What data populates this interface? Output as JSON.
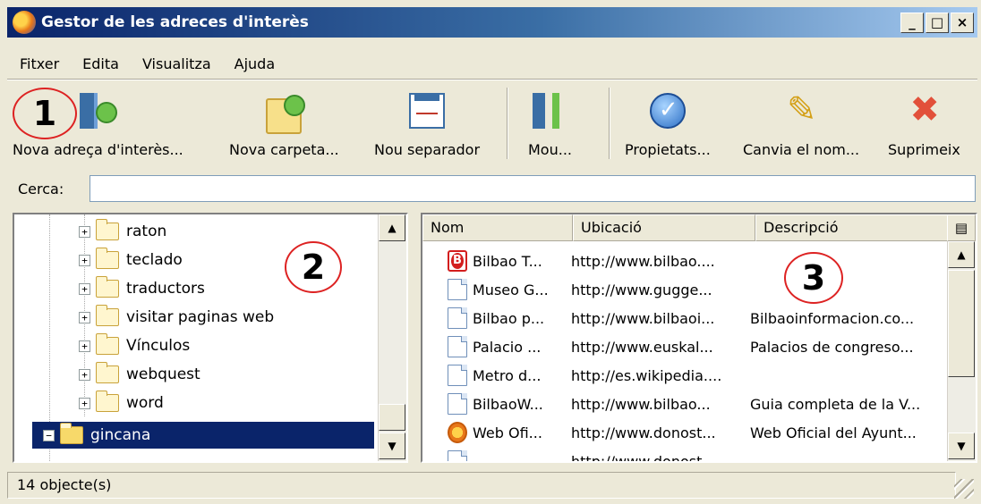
{
  "window": {
    "title": "Gestor de les adreces d'interès",
    "controls": [
      "_",
      "□",
      "×"
    ]
  },
  "menu": [
    "Fitxer",
    "Edita",
    "Visualitza",
    "Ajuda"
  ],
  "toolbar": {
    "new_bookmark": "Nova adreça d'interès...",
    "new_folder": "Nova carpeta...",
    "new_separator": "Nou separador",
    "move": "Mou...",
    "properties": "Propietats...",
    "rename": "Canvia el nom...",
    "delete": "Suprimeix"
  },
  "markers": [
    "1",
    "2",
    "3"
  ],
  "search": {
    "label": "Cerca:",
    "value": ""
  },
  "tree": {
    "items": [
      "raton",
      "teclado",
      "traductors",
      "visitar paginas web",
      "Vínculos",
      "webquest",
      "word"
    ],
    "selected": "gincana"
  },
  "list": {
    "columns": [
      "Nom",
      "Ubicació",
      "Descripció"
    ],
    "rows": [
      {
        "icon": "bilbao-logo-icon",
        "name": "Bilbao T...",
        "url": "http://www.bilbao....",
        "desc": ""
      },
      {
        "icon": "page-icon",
        "name": "Museo G...",
        "url": "http://www.gugge...",
        "desc": ""
      },
      {
        "icon": "page-icon",
        "name": "Bilbao p...",
        "url": "http://www.bilbaoi...",
        "desc": "Bilbaoinformacion.co..."
      },
      {
        "icon": "page-icon",
        "name": "Palacio ...",
        "url": "http://www.euskal...",
        "desc": "Palacios de congreso..."
      },
      {
        "icon": "page-icon",
        "name": "Metro d...",
        "url": "http://es.wikipedia....",
        "desc": ""
      },
      {
        "icon": "page-icon",
        "name": "BilbaoW...",
        "url": "http://www.bilbao...",
        "desc": "Guia completa de la V..."
      },
      {
        "icon": "donostia-logo-icon",
        "name": "Web Ofi...",
        "url": "http://www.donost...",
        "desc": "Web Oficial del Ayunt..."
      },
      {
        "icon": "page-icon",
        "name": "...",
        "url": "http://www.donost...",
        "desc": ""
      }
    ]
  },
  "status": {
    "text": "14 objecte(s)"
  }
}
